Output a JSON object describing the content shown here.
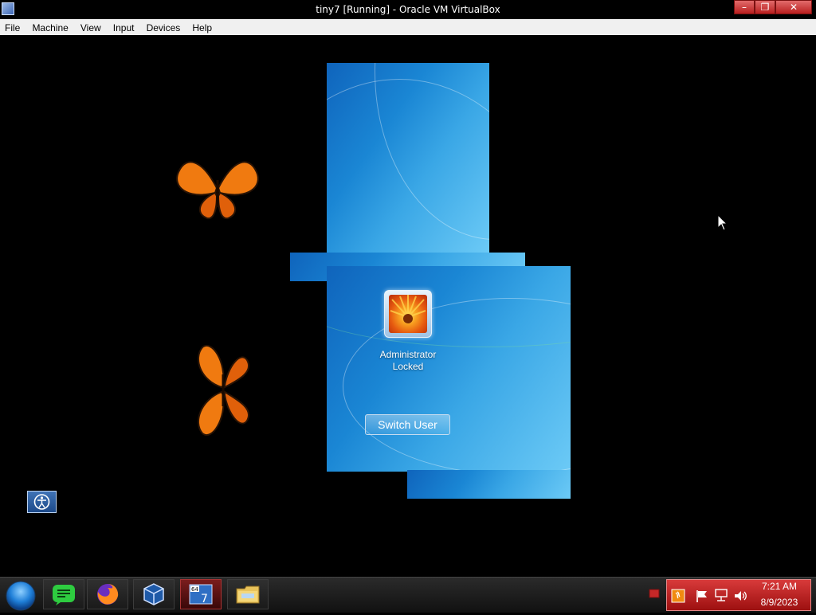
{
  "window": {
    "title": "tiny7 [Running] - Oracle VM VirtualBox",
    "controls": {
      "minimize": "–",
      "restore": "❐",
      "close": "✕"
    }
  },
  "menu": {
    "items": [
      {
        "label": "File"
      },
      {
        "label": "Machine"
      },
      {
        "label": "View"
      },
      {
        "label": "Input"
      },
      {
        "label": "Devices"
      },
      {
        "label": "Help"
      }
    ]
  },
  "login": {
    "user_name": "Administrator",
    "user_status": "Locked",
    "switch_user_label": "Switch User"
  },
  "taskbar": {
    "apps": [
      {
        "icon": "sticky-notes-icon"
      },
      {
        "icon": "firefox-icon"
      },
      {
        "icon": "virtualbox-icon"
      },
      {
        "icon": "windows7-64-icon",
        "badge_top": "64",
        "badge_num": "7"
      },
      {
        "icon": "file-explorer-icon"
      }
    ],
    "clock": {
      "time": "7:21 AM",
      "date": "8/9/2023"
    }
  },
  "colors": {
    "accent_red": "#c62828",
    "win7_blue": "#1a86d4",
    "butterfly_orange": "#f07a10"
  }
}
